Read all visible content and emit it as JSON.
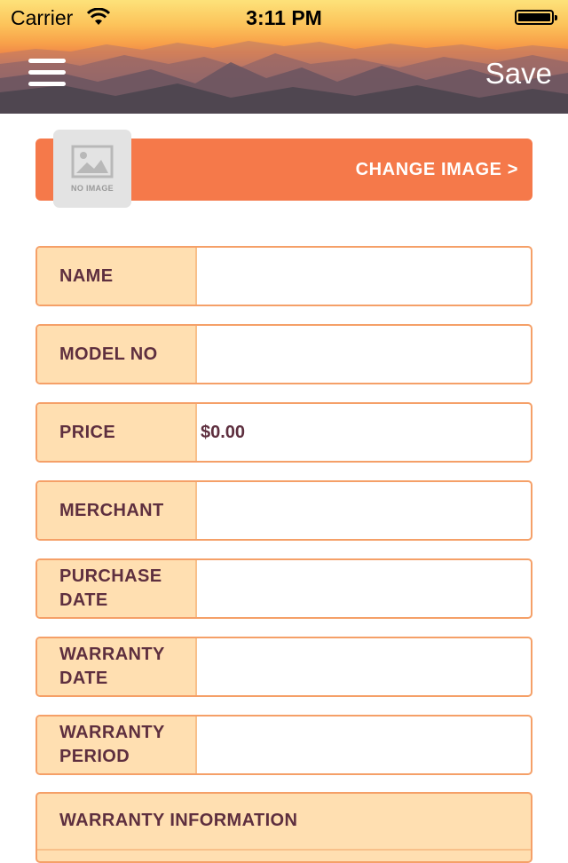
{
  "status_bar": {
    "carrier": "Carrier",
    "time": "3:11 PM"
  },
  "nav": {
    "menu_icon": "hamburger-menu-icon",
    "save_label": "Save"
  },
  "image_section": {
    "placeholder_label": "NO IMAGE",
    "change_label": "CHANGE IMAGE >",
    "accent_color": "#f5794a"
  },
  "fields": [
    {
      "label": "NAME",
      "value": ""
    },
    {
      "label": "MODEL NO",
      "value": ""
    },
    {
      "label": "PRICE",
      "value": "$0.00"
    },
    {
      "label": "MERCHANT",
      "value": ""
    },
    {
      "label": "PURCHASE DATE",
      "value": ""
    },
    {
      "label": "WARRANTY DATE",
      "value": ""
    },
    {
      "label": "WARRANTY PERIOD",
      "value": ""
    }
  ],
  "warranty_info": {
    "label": "WARRANTY INFORMATION"
  },
  "colors": {
    "label_bg": "#ffdfb1",
    "label_text": "#5e2f3f",
    "border": "#f5a068"
  }
}
